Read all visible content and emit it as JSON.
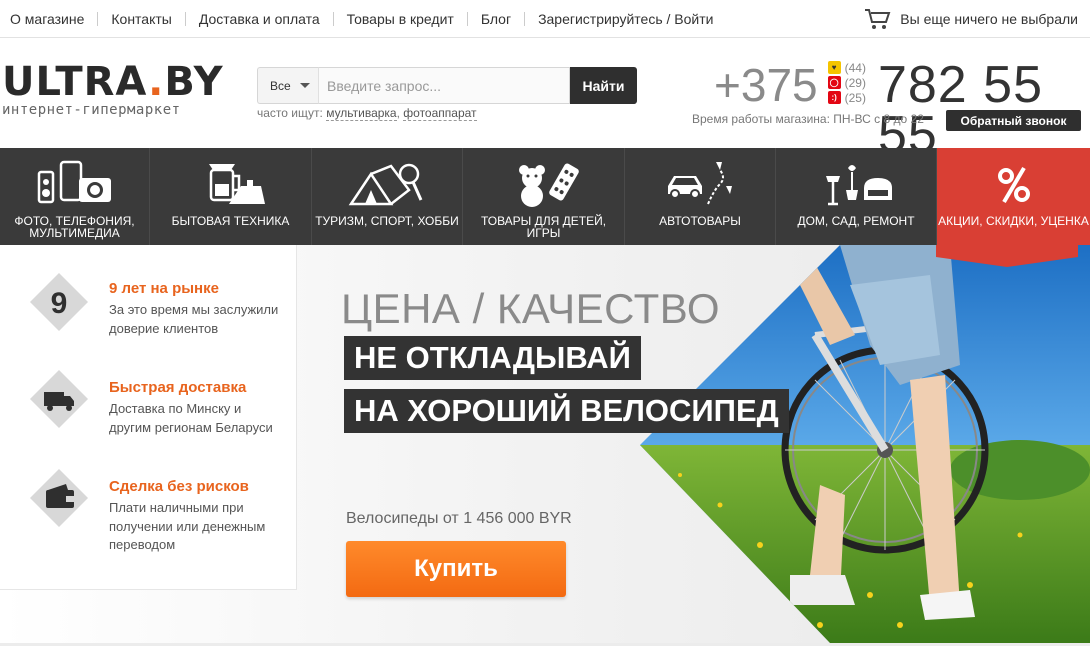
{
  "topnav": {
    "links": [
      "О магазине",
      "Контакты",
      "Доставка и оплата",
      "Товары в кредит",
      "Блог",
      "Зарегистрируйтесь / Войти"
    ]
  },
  "cart": {
    "text": "Вы еще ничего не выбрали",
    "icon": "cart-icon"
  },
  "logo": {
    "main": "ULTRA",
    "dot": ".",
    "tld": "BY",
    "sub": "интернет-гипермаркет"
  },
  "search": {
    "category": "Все",
    "placeholder": "Введите запрос...",
    "button": "Найти",
    "often_label": "часто ищут:",
    "often_links": [
      "мультиварка",
      "фотоаппарат"
    ]
  },
  "contact": {
    "code": "+375",
    "operators": [
      {
        "code": "(44)",
        "color": "#f5c400",
        "icon": "velcom-icon"
      },
      {
        "code": "(29)",
        "color": "#e30613",
        "icon": "mts-icon"
      },
      {
        "code": "(25)",
        "color": "#e30613",
        "icon": "life-icon"
      }
    ],
    "number": "782 55 55",
    "hours": "Время работы магазина: ПН-ВС с 8 до 22",
    "callback": "Обратный звонок"
  },
  "categories": [
    {
      "label": "Фото, телефония, мультимедиа",
      "icon": "camera-phone-icon"
    },
    {
      "label": "Бытовая техника",
      "icon": "appliance-icon"
    },
    {
      "label": "Туризм, спорт, хобби",
      "icon": "tent-racket-icon"
    },
    {
      "label": "Товары для детей, игры",
      "icon": "teddy-bear-icon"
    },
    {
      "label": "Автотовары",
      "icon": "car-icon"
    },
    {
      "label": "Дом, сад, ремонт",
      "icon": "home-garden-icon"
    },
    {
      "label": "Акции, скидки, уценка",
      "icon": "percent-icon"
    }
  ],
  "benefits": [
    {
      "badge": "9",
      "title": "9 лет на рынке",
      "text": "За это время мы заслужили доверие клиентов",
      "icon": "nine-badge-icon"
    },
    {
      "badge": "",
      "title": "Быстрая доставка",
      "text": "Доставка по Минску и другим регионам Беларуси",
      "icon": "truck-icon"
    },
    {
      "badge": "",
      "title": "Сделка без рисков",
      "text": "Плати наличными при получении или денежным переводом",
      "icon": "wallet-icon"
    }
  ],
  "hero": {
    "title": "ЦЕНА / КАЧЕСТВО",
    "line1": "НЕ ОТКЛАДЫВАЙ",
    "line2": "НА ХОРОШИЙ ВЕЛОСИПЕД",
    "price": "Велосипеды от 1 456 000 BYR",
    "button": "Купить",
    "image": "bicycle-photo"
  },
  "colors": {
    "accent": "#e8641e",
    "nav_bg": "#3a3a3a",
    "sale_bg": "#d93f34",
    "buy_button": "#f36a12"
  }
}
